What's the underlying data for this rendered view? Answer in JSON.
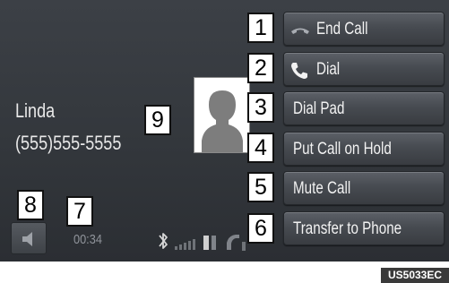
{
  "caller": {
    "name": "Linda",
    "number": "(555)555-5555",
    "photo_icon": "contact-silhouette"
  },
  "call_menu": {
    "items": [
      {
        "label": "End Call",
        "icon": "hang-up-icon"
      },
      {
        "label": "Dial",
        "icon": "phone-icon"
      },
      {
        "label": "Dial Pad",
        "icon": ""
      },
      {
        "label": "Put Call on Hold",
        "icon": ""
      },
      {
        "label": "Mute Call",
        "icon": ""
      },
      {
        "label": "Transfer to Phone",
        "icon": ""
      }
    ]
  },
  "call_timer": "00:34",
  "status": {
    "icons": [
      "bluetooth-icon",
      "signal-strength-icon",
      "battery-icon",
      "phone-handset-icon"
    ]
  },
  "callouts": [
    "1",
    "2",
    "3",
    "4",
    "5",
    "6",
    "7",
    "8",
    "9"
  ],
  "figure_code": "US5033EC",
  "colors": {
    "screen_background": "#33373c",
    "button_background": "#474b51",
    "text": "#f2f2f2",
    "timer_text": "#8f939a"
  }
}
